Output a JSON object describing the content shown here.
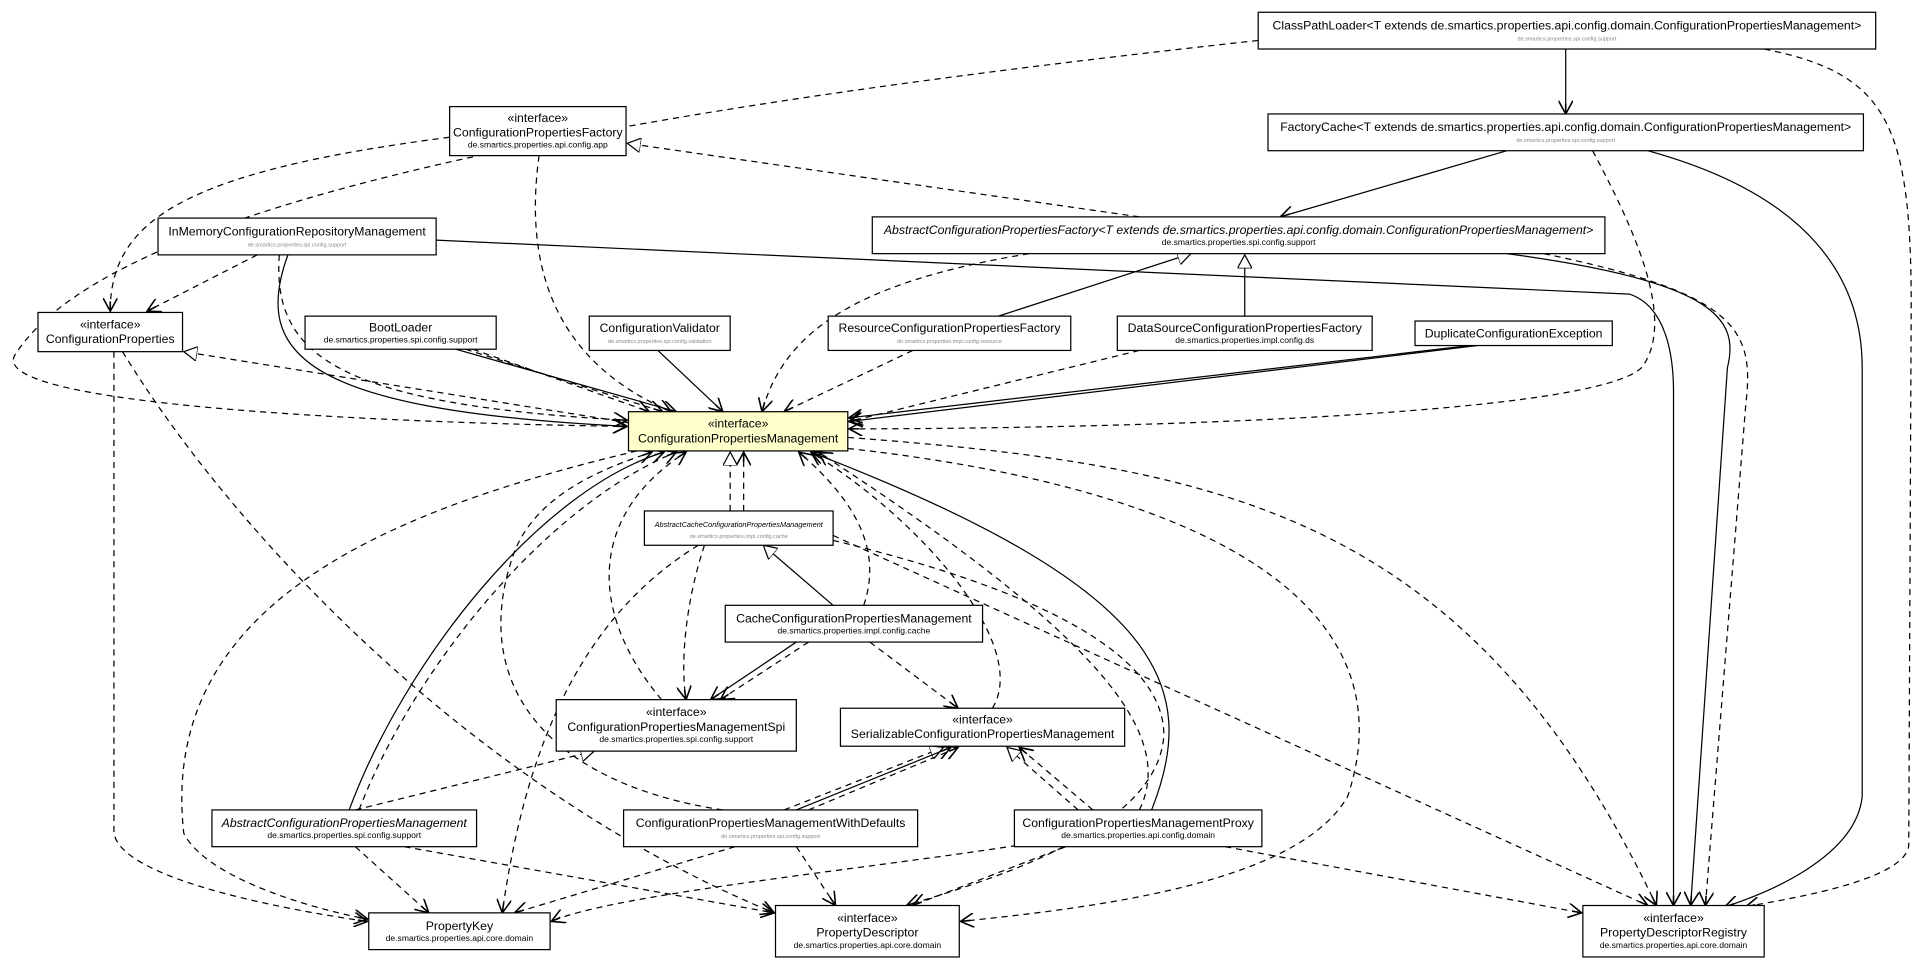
{
  "diagram": {
    "highlight_color": "#ffffcc",
    "nodes": [
      {
        "id": "classpathloader",
        "name": "ClassPathLoader<T extends de.smartics.properties.api.config.domain.ConfigurationPropertiesManagement>",
        "package": "de.smartics.properties.spi.config.support",
        "package_style": "faint"
      },
      {
        "id": "factorycache",
        "name": "FactoryCache<T extends de.smartics.properties.api.config.domain.ConfigurationPropertiesManagement>",
        "package": "de.smartics.properties.spi.config.support",
        "package_style": "faint"
      },
      {
        "id": "cpfactory",
        "stereotype": "«interface»",
        "name": "ConfigurationPropertiesFactory",
        "package": "de.smartics.properties.api.config.app",
        "package_style": "bold"
      },
      {
        "id": "abstractcpfactory",
        "name": "AbstractConfigurationPropertiesFactory<T extends de.smartics.properties.api.config.domain.ConfigurationPropertiesManagement>",
        "package": "de.smartics.properties.spi.config.support",
        "package_style": "bold",
        "abstract": true
      },
      {
        "id": "inmemory",
        "name": "InMemoryConfigurationRepositoryManagement",
        "package": "de.smartics.properties.spi.config.support",
        "package_style": "faint"
      },
      {
        "id": "configprops",
        "stereotype": "«interface»",
        "name": "ConfigurationProperties"
      },
      {
        "id": "bootloader",
        "name": "BootLoader",
        "package": "de.smartics.properties.spi.config.support",
        "package_style": "bold"
      },
      {
        "id": "validator",
        "name": "ConfigurationValidator",
        "package": "de.smartics.properties.spi.config.validation",
        "package_style": "faint"
      },
      {
        "id": "resourcefactory",
        "name": "ResourceConfigurationPropertiesFactory",
        "package": "de.smartics.properties.impl.config.resource",
        "package_style": "faint"
      },
      {
        "id": "datasourcefactory",
        "name": "DataSourceConfigurationPropertiesFactory",
        "package": "de.smartics.properties.impl.config.ds",
        "package_style": "bold"
      },
      {
        "id": "duplicate",
        "name": "DuplicateConfigurationException"
      },
      {
        "id": "cpm",
        "stereotype": "«interface»",
        "name": "ConfigurationPropertiesManagement",
        "highlighted": true
      },
      {
        "id": "abstractcache",
        "name": "AbstractCacheConfigurationPropertiesManagement",
        "package": "de.smartics.properties.impl.config.cache",
        "package_style": "faint",
        "abstract": true,
        "small": true
      },
      {
        "id": "cachecpm",
        "name": "CacheConfigurationPropertiesManagement",
        "package": "de.smartics.properties.impl.config.cache",
        "package_style": "bold"
      },
      {
        "id": "cpmspi",
        "stereotype": "«interface»",
        "name": "ConfigurationPropertiesManagementSpi",
        "package": "de.smartics.properties.spi.config.support",
        "package_style": "bold"
      },
      {
        "id": "serializable",
        "stereotype": "«interface»",
        "name": "SerializableConfigurationPropertiesManagement"
      },
      {
        "id": "abstractcpm",
        "name": "AbstractConfigurationPropertiesManagement",
        "package": "de.smartics.properties.spi.config.support",
        "package_style": "bold",
        "abstract": true
      },
      {
        "id": "withdefaults",
        "name": "ConfigurationPropertiesManagementWithDefaults",
        "package": "de.smartics.properties.spi.config.support",
        "package_style": "faint"
      },
      {
        "id": "proxy",
        "name": "ConfigurationPropertiesManagementProxy",
        "package": "de.smartics.properties.api.config.domain",
        "package_style": "bold"
      },
      {
        "id": "propertykey",
        "name": "PropertyKey",
        "package": "de.smartics.properties.api.core.domain",
        "package_style": "bold"
      },
      {
        "id": "propertydescriptor",
        "stereotype": "«interface»",
        "name": "PropertyDescriptor",
        "package": "de.smartics.properties.api.core.domain",
        "package_style": "bold"
      },
      {
        "id": "registry",
        "stereotype": "«interface»",
        "name": "PropertyDescriptorRegistry",
        "package": "de.smartics.properties.api.core.domain",
        "package_style": "bold"
      }
    ]
  }
}
